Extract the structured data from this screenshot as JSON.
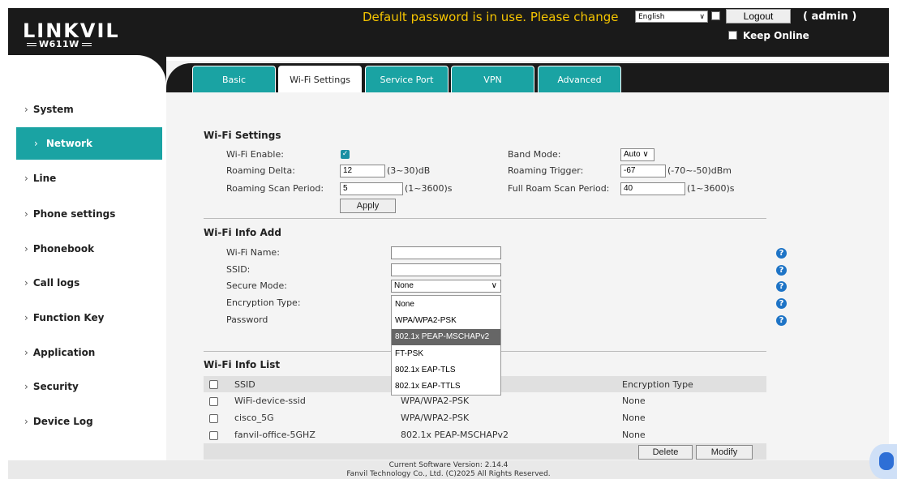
{
  "header": {
    "logo": "LINKVIL",
    "model": "W611W",
    "warning": "Default password is in use. Please change",
    "language": "English",
    "logout_label": "Logout",
    "user": "( admin )",
    "keep_online": "Keep Online"
  },
  "sidebar": {
    "items": [
      {
        "label": "System"
      },
      {
        "label": "Network"
      },
      {
        "label": "Line"
      },
      {
        "label": "Phone settings"
      },
      {
        "label": "Phonebook"
      },
      {
        "label": "Call logs"
      },
      {
        "label": "Function Key"
      },
      {
        "label": "Application"
      },
      {
        "label": "Security"
      },
      {
        "label": "Device Log"
      }
    ],
    "active": "Network"
  },
  "tabs": [
    {
      "label": "Basic"
    },
    {
      "label": "Wi-Fi Settings"
    },
    {
      "label": "Service Port"
    },
    {
      "label": "VPN"
    },
    {
      "label": "Advanced"
    }
  ],
  "wifi_settings": {
    "title": "Wi-Fi Settings",
    "enable_label": "Wi-Fi Enable:",
    "enable_checked": true,
    "band_mode_label": "Band Mode:",
    "band_mode_value": "Auto",
    "roaming_delta_label": "Roaming Delta:",
    "roaming_delta_value": "12",
    "roaming_delta_range": "(3~30)dB",
    "roaming_trigger_label": "Roaming Trigger:",
    "roaming_trigger_value": "-67",
    "roaming_trigger_range": "(-70~-50)dBm",
    "scan_period_label": "Roaming Scan Period:",
    "scan_period_value": "5",
    "scan_period_range": "(1~3600)s",
    "full_scan_label": "Full Roam Scan Period:",
    "full_scan_value": "40",
    "full_scan_range": "(1~3600)s",
    "apply_label": "Apply"
  },
  "wifi_info_add": {
    "title": "Wi-Fi Info Add",
    "name_label": "Wi-Fi Name:",
    "ssid_label": "SSID:",
    "secure_mode_label": "Secure Mode:",
    "secure_mode_value": "None",
    "encryption_label": "Encryption Type:",
    "password_label": "Password",
    "dropdown_options": [
      "None",
      "WPA/WPA2-PSK",
      "802.1x PEAP-MSCHAPv2",
      "FT-PSK",
      "802.1x EAP-TLS",
      "802.1x EAP-TTLS"
    ],
    "dropdown_highlight": "802.1x PEAP-MSCHAPv2"
  },
  "wifi_info_list": {
    "title": "Wi-Fi Info List",
    "columns": [
      "SSID",
      "Encryption Type"
    ],
    "rows": [
      {
        "ssid": "WiFi-device-ssid",
        "mode": "WPA/WPA2-PSK",
        "encryption": "None"
      },
      {
        "ssid": "cisco_5G",
        "mode": "WPA/WPA2-PSK",
        "encryption": "None"
      },
      {
        "ssid": "fanvil-office-5GHZ",
        "mode": "802.1x PEAP-MSCHAPv2",
        "encryption": "None"
      }
    ],
    "delete_label": "Delete",
    "modify_label": "Modify"
  },
  "footer": {
    "version": "Current Software Version: 2.14.4",
    "copyright": "Fanvil Technology Co., Ltd. (C)2025 All Rights Reserved."
  },
  "colors": {
    "accent": "#1aa3a3",
    "header_bg": "#1a1a1a",
    "warning": "#f5c400"
  }
}
